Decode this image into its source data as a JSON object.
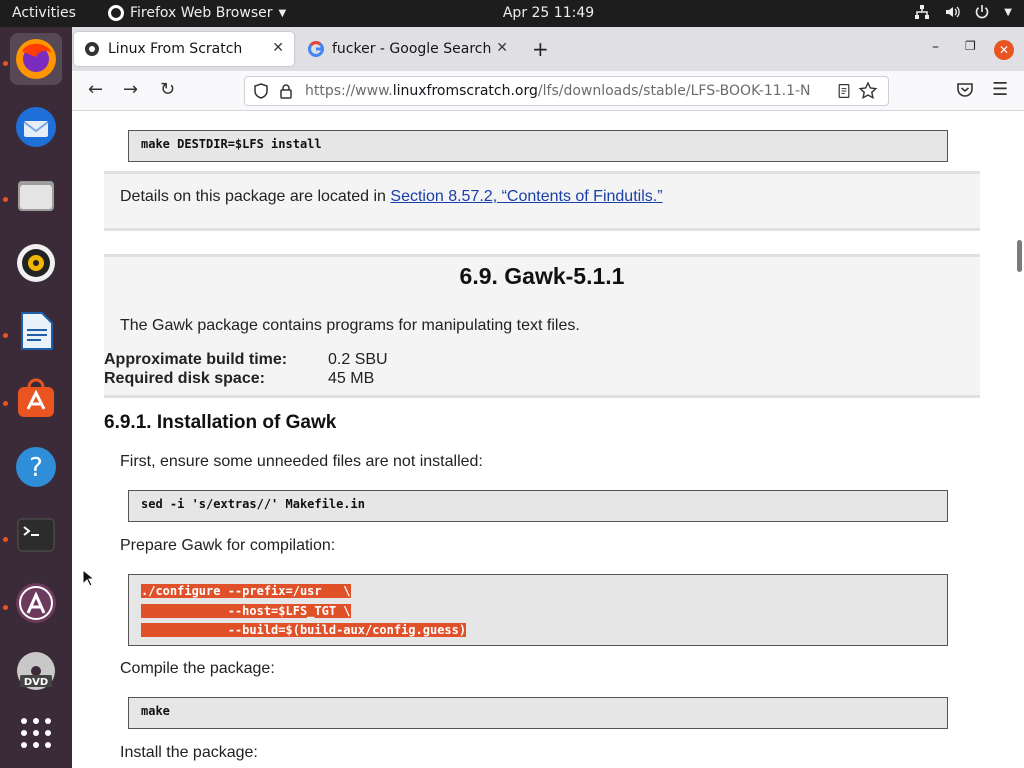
{
  "topbar": {
    "activities": "Activities",
    "app_name": "Firefox Web Browser",
    "clock": "Apr 25  11:49"
  },
  "dock": {
    "items": [
      "firefox",
      "thunderbird",
      "files",
      "rhythmbox",
      "libreoffice-writer",
      "software",
      "help",
      "terminal",
      "app-installer",
      "dvd"
    ]
  },
  "browser": {
    "tabs": [
      {
        "title": "Linux From Scratch"
      },
      {
        "title": "fucker - Google Search"
      }
    ],
    "url": {
      "scheme": "https://www.",
      "domain": "linuxfromscratch.org",
      "path": "/lfs/downloads/stable/LFS-BOOK-11.1-N"
    }
  },
  "page": {
    "code_install": "make DESTDIR=$LFS install",
    "details_prefix": "Details on this package are located in ",
    "details_link": "Section 8.57.2, “Contents of Findutils.”",
    "section_title": "6.9. Gawk-5.1.1",
    "intro": "The Gawk package contains programs for manipulating text files.",
    "build_time_label": "Approximate build time:",
    "build_time_value": "0.2 SBU",
    "disk_space_label": "Required disk space:",
    "disk_space_value": "45 MB",
    "subsection_title": "6.9.1. Installation of Gawk",
    "step1": "First, ensure some unneeded files are not installed:",
    "code_sed": "sed -i 's/extras//' Makefile.in",
    "step2": "Prepare Gawk for compilation:",
    "code_configure": [
      "./configure --prefix=/usr   \\",
      "            --host=$LFS_TGT \\",
      "            --build=$(build-aux/config.guess)"
    ],
    "step3": "Compile the package:",
    "code_make": "make",
    "step4": "Install the package:"
  },
  "colors": {
    "accent": "#e95420",
    "dock_bg": "#3b2a38",
    "link": "#1a3ea8"
  }
}
